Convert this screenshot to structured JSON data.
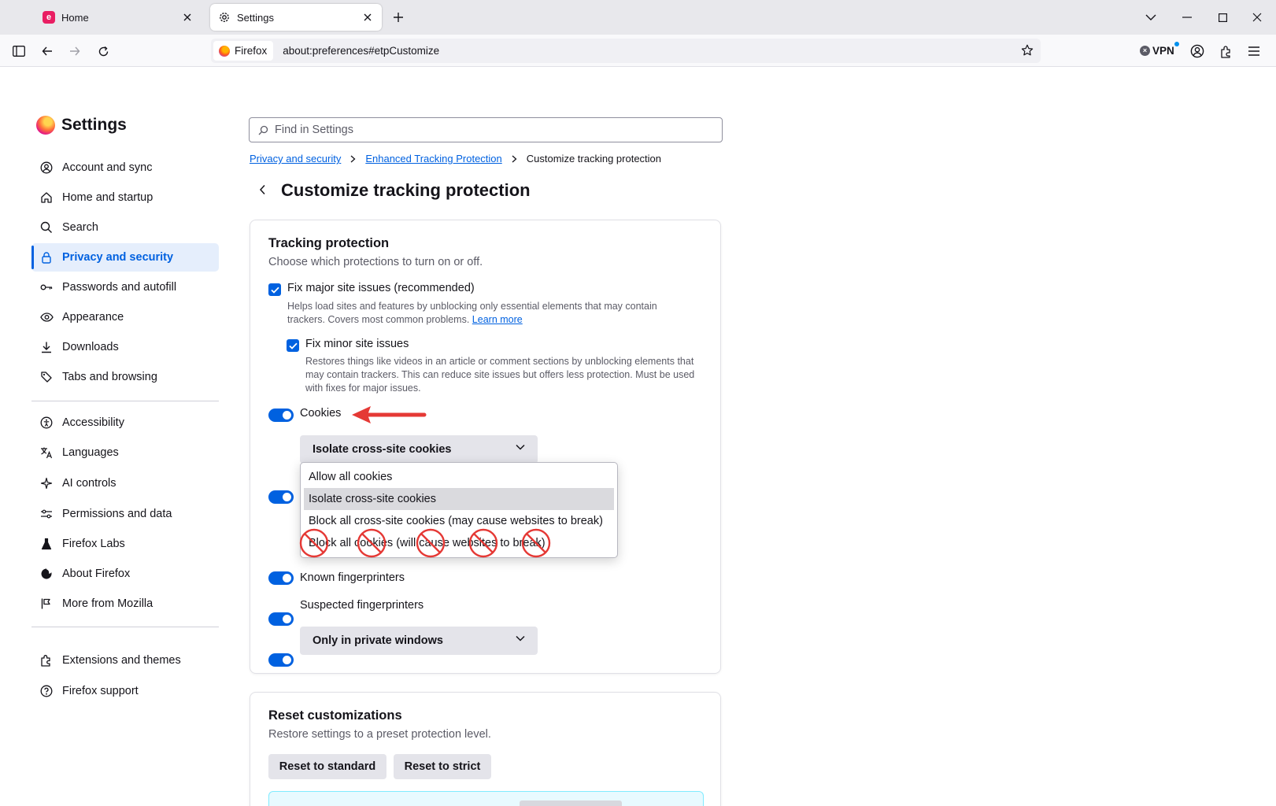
{
  "window": {
    "tabs": [
      {
        "title": "Home",
        "favicon": "home-app-icon",
        "active": false
      },
      {
        "title": "Settings",
        "favicon": "gear-icon",
        "active": true
      }
    ],
    "url_identity": "Firefox",
    "url": "about:preferences#etpCustomize",
    "vpn_label": "VPN"
  },
  "sidebar": {
    "title": "Settings",
    "groups": [
      [
        {
          "label": "Account and sync",
          "icon": "account-icon"
        },
        {
          "label": "Home and startup",
          "icon": "home-icon"
        },
        {
          "label": "Search",
          "icon": "search-icon"
        },
        {
          "label": "Privacy and security",
          "icon": "lock-icon",
          "selected": true
        },
        {
          "label": "Passwords and autofill",
          "icon": "key-icon"
        },
        {
          "label": "Appearance",
          "icon": "eye-icon"
        },
        {
          "label": "Downloads",
          "icon": "download-icon"
        },
        {
          "label": "Tabs and browsing",
          "icon": "tabs-icon"
        }
      ],
      [
        {
          "label": "Accessibility",
          "icon": "accessibility-icon"
        },
        {
          "label": "Languages",
          "icon": "translate-icon"
        },
        {
          "label": "AI controls",
          "icon": "sparkle-icon"
        },
        {
          "label": "Permissions and data",
          "icon": "sliders-icon"
        },
        {
          "label": "Firefox Labs",
          "icon": "flask-icon"
        },
        {
          "label": "About Firefox",
          "icon": "firefox-icon"
        },
        {
          "label": "More from Mozilla",
          "icon": "mozilla-icon"
        }
      ],
      [
        {
          "label": "Extensions and themes",
          "icon": "puzzle-icon"
        },
        {
          "label": "Firefox support",
          "icon": "help-icon"
        }
      ]
    ]
  },
  "main": {
    "search_placeholder": "Find in Settings",
    "breadcrumb": [
      "Privacy and security",
      "Enhanced Tracking Protection",
      "Customize tracking protection"
    ],
    "title": "Customize tracking protection",
    "tracking": {
      "title": "Tracking protection",
      "subtitle": "Choose which protections to turn on or off.",
      "fix_major": {
        "label": "Fix major site issues (recommended)",
        "desc": "Helps load sites and features by unblocking only essential elements that may contain trackers. Covers most common problems.",
        "link": "Learn more",
        "checked": true
      },
      "fix_minor": {
        "label": "Fix minor site issues",
        "desc": "Restores things like videos in an article or comment sections by unblocking elements that may contain trackers. This can reduce site issues but offers less protection. Must be used with fixes for major issues.",
        "checked": true
      },
      "cookies": {
        "label": "Cookies",
        "enabled": true,
        "selected": "Isolate cross-site cookies",
        "options": [
          "Allow all cookies",
          "Isolate cross-site cookies",
          "Block all cross-site cookies (may cause websites to break)",
          "Block all cookies (will cause websites to break)"
        ],
        "highlighted_index": 1
      },
      "known_fingerprinters": {
        "label": "Known fingerprinters",
        "enabled": true
      },
      "suspected_fingerprinters": {
        "label": "Suspected fingerprinters",
        "enabled": true,
        "selected": "Only in private windows"
      }
    },
    "reset": {
      "title": "Reset customizations",
      "subtitle": "Restore settings to a preset protection level.",
      "standard_button": "Reset to standard",
      "strict_button": "Reset to strict"
    }
  },
  "colors": {
    "accent": "#0061e0",
    "annotation_red": "#e53935",
    "selected_nav_bg": "#e5eefc"
  }
}
